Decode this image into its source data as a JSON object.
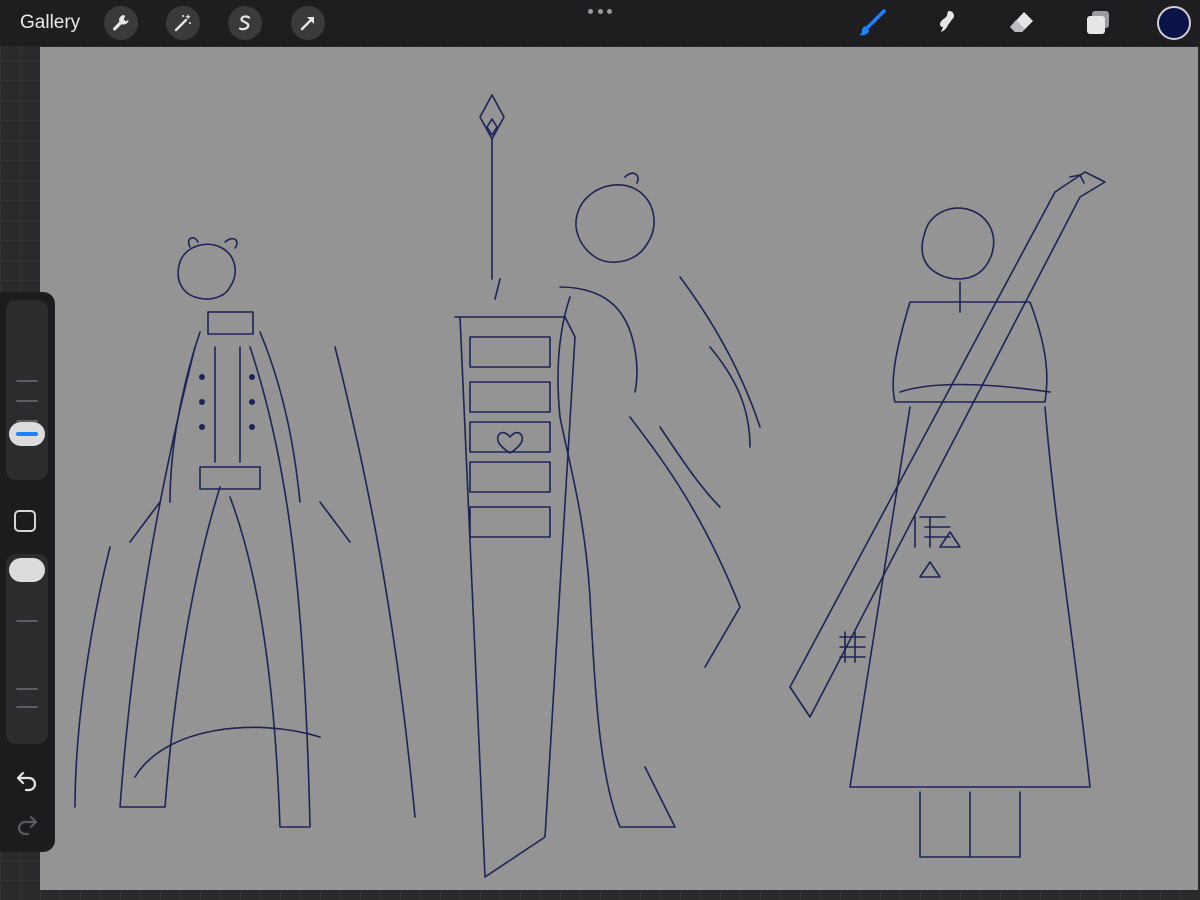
{
  "topbar": {
    "gallery_label": "Gallery",
    "left_tools": [
      "wrench-icon",
      "magic-wand-icon",
      "selection-s-icon",
      "transform-arrow-icon"
    ],
    "right_tools": [
      "brush-icon",
      "smudge-icon",
      "eraser-icon",
      "layers-icon"
    ],
    "active_tool": "brush-icon",
    "current_color": "#0b1446"
  },
  "sidebar": {
    "brush_size_level": 0.2,
    "opacity_level": 1.0
  },
  "colors": {
    "canvas": "#949494",
    "ink": "#1c2556",
    "accent": "#1a84ff"
  }
}
